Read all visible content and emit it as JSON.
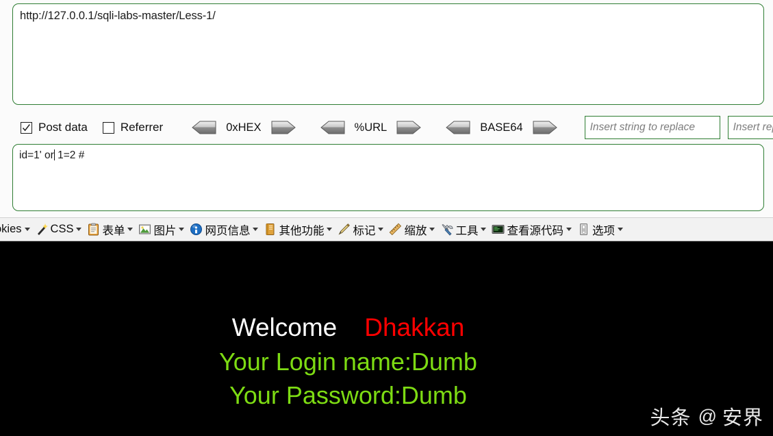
{
  "hackbar": {
    "url_value": "http://127.0.0.1/sqli-labs-master/Less-1/",
    "checkboxes": [
      {
        "label": "Post data",
        "checked": true,
        "name": "post-data"
      },
      {
        "label": "Referrer",
        "checked": false,
        "name": "referrer"
      }
    ],
    "encoders": [
      {
        "label": "0xHEX",
        "left_arrow": "decode-arrow",
        "right_arrow": "encode-arrow"
      },
      {
        "label": "%URL",
        "left_arrow": "decode-arrow",
        "right_arrow": "encode-arrow"
      },
      {
        "label": "BASE64",
        "left_arrow": "decode-arrow",
        "right_arrow": "encode-arrow"
      }
    ],
    "replace_search_placeholder": "Insert string to replace",
    "replace_with_placeholder": "Insert rep",
    "post_data_value_before_caret": "id=1' or",
    "post_data_value_after_caret": " 1=2 #",
    "post_data_full": "id=1' or 1=2 #",
    "border_color": "#2e7d32"
  },
  "webdev_toolbar": {
    "items": [
      {
        "label": "okies",
        "icon": "cookie-icon",
        "has_icon": false,
        "caret": true
      },
      {
        "label": "CSS",
        "icon": "css-wand-icon",
        "has_icon": true,
        "caret": true
      },
      {
        "label": "表单",
        "icon": "forms-clipboard-icon",
        "has_icon": true,
        "caret": true
      },
      {
        "label": "图片",
        "icon": "images-picture-icon",
        "has_icon": true,
        "caret": true
      },
      {
        "label": "网页信息",
        "icon": "information-info-icon",
        "has_icon": true,
        "caret": true
      },
      {
        "label": "其他功能",
        "icon": "misc-book-icon",
        "has_icon": true,
        "caret": true
      },
      {
        "label": "标记",
        "icon": "outline-pencil-icon",
        "has_icon": true,
        "caret": true
      },
      {
        "label": "缩放",
        "icon": "resize-ruler-icon",
        "has_icon": true,
        "caret": true
      },
      {
        "label": "工具",
        "icon": "tools-wrench-icon",
        "has_icon": true,
        "caret": true
      },
      {
        "label": "查看源代码",
        "icon": "view-source-screen-icon",
        "has_icon": true,
        "caret": true
      },
      {
        "label": "选项",
        "icon": "options-switch-icon",
        "has_icon": true,
        "caret": true
      }
    ]
  },
  "page_content": {
    "welcome_text": "Welcome",
    "welcome_name": "Dhakkan",
    "login_line": "Your Login name:Dumb",
    "password_line": "Your Password:Dumb",
    "background_color": "#000000",
    "welcome_color": "#ffffff",
    "name_color": "#ff0000",
    "credentials_color": "#7ddb13"
  },
  "watermark": {
    "brand": "头条",
    "at": "@",
    "author": "安界"
  }
}
